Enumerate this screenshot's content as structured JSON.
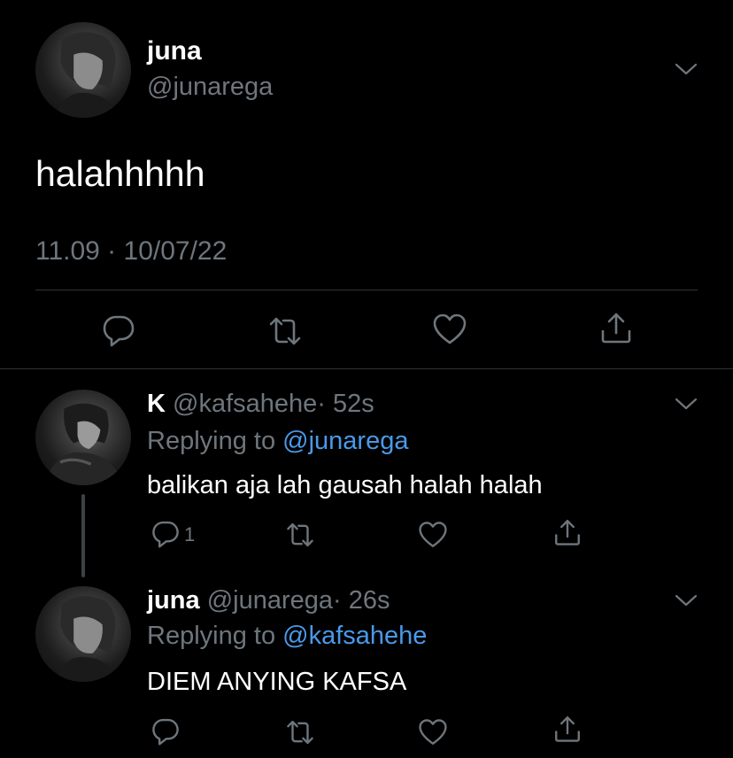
{
  "main_tweet": {
    "name": "juna",
    "handle": "@junarega",
    "text": "halahhhhh",
    "timestamp": "11.09 · 10/07/22"
  },
  "replies": [
    {
      "name": "K",
      "handle": "@kafsahehe",
      "age": "· 52s",
      "replying_label": "Replying to",
      "replying_to": "@junarega",
      "text": "balikan aja lah gausah halah halah",
      "reply_count": "1"
    },
    {
      "name": "juna",
      "handle": "@junarega",
      "age": "· 26s",
      "replying_label": "Replying to",
      "replying_to": "@kafsahehe",
      "text": "DIEM ANYING KAFSA",
      "reply_count": ""
    }
  ],
  "icons": {
    "reply": "reply-icon",
    "retweet": "retweet-icon",
    "like": "heart-icon",
    "share": "share-icon",
    "more": "chevron-down-icon"
  },
  "colors": {
    "background": "#000000",
    "text": "#ffffff",
    "secondary": "#6e767d",
    "link": "#4a99e9",
    "divider": "#2f3336"
  }
}
